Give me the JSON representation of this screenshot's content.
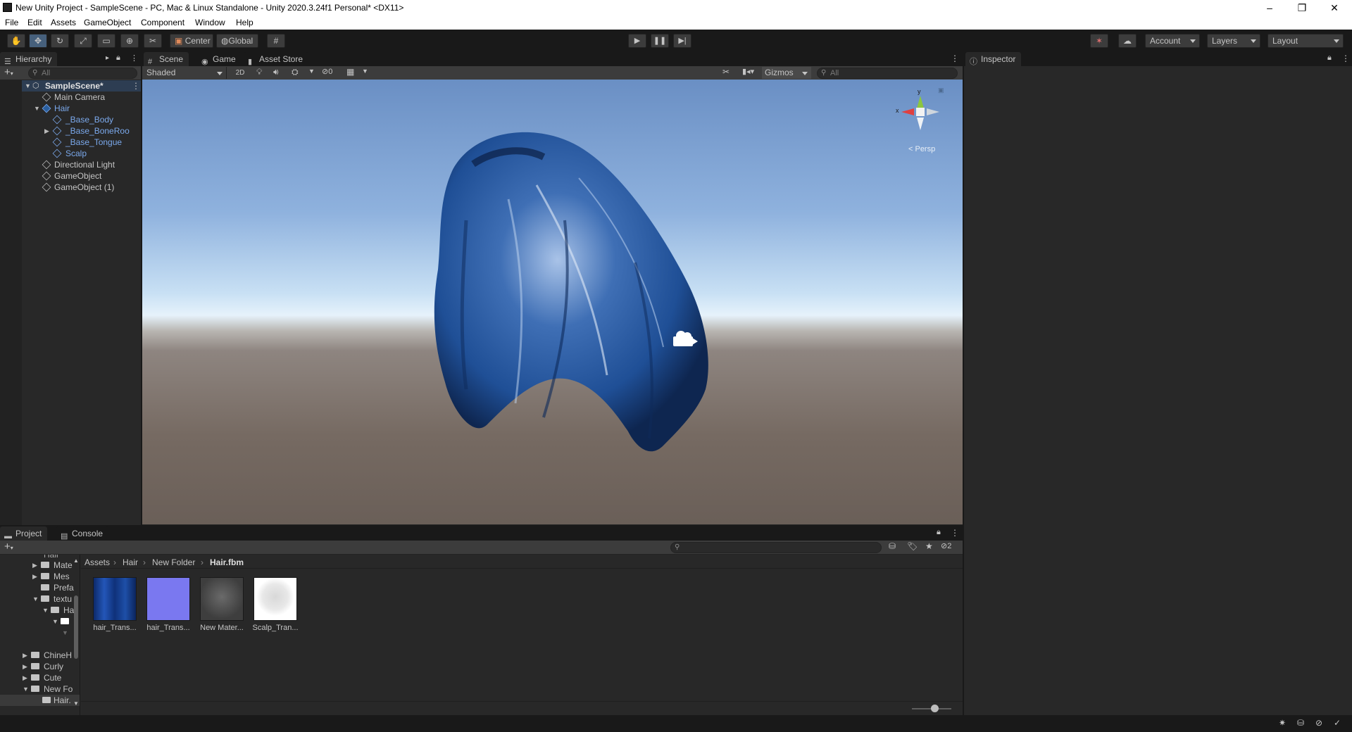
{
  "window": {
    "title": "New Unity Project - SampleScene - PC, Mac & Linux Standalone - Unity 2020.3.24f1 Personal* <DX11>",
    "controls": [
      "–",
      "❐",
      "✕"
    ]
  },
  "menu": [
    "File",
    "Edit",
    "Assets",
    "GameObject",
    "Component",
    "Window",
    "Help"
  ],
  "toolbar": {
    "pivot_label": "Center",
    "space_label": "Global",
    "account_label": "Account",
    "layers_label": "Layers",
    "layout_label": "Layout"
  },
  "hierarchy": {
    "tab_label": "Hierarchy",
    "search_placeholder": "All",
    "scene_name": "SampleScene*",
    "items": [
      {
        "label": "Main Camera"
      },
      {
        "label": "Hair"
      },
      {
        "label": "_Base_Body"
      },
      {
        "label": "_Base_BoneRoo"
      },
      {
        "label": "_Base_Tongue"
      },
      {
        "label": "Scalp"
      },
      {
        "label": "Directional Light"
      },
      {
        "label": "GameObject"
      },
      {
        "label": "GameObject (1)"
      }
    ]
  },
  "scene": {
    "tabs": [
      "Scene",
      "Game",
      "Asset Store"
    ],
    "shading_mode": "Shaded",
    "mode_2d": "2D",
    "hidden_count": "0",
    "gizmos_label": "Gizmos",
    "search_placeholder": "All",
    "gizmo_x": "x",
    "gizmo_y": "y",
    "projection": "< Persp",
    "colors": {
      "hair": "#1f4f96",
      "sky": "#8fb2de",
      "ground": "#766a62"
    }
  },
  "inspector": {
    "tab_label": "Inspector"
  },
  "project": {
    "tabs": [
      "Project",
      "Console"
    ],
    "hidden_count": "2",
    "breadcrumb": [
      "Assets",
      "Hair",
      "New Folder",
      "Hair.fbm"
    ],
    "tree": [
      {
        "label": "Hair"
      },
      {
        "label": "Mate"
      },
      {
        "label": "Mes"
      },
      {
        "label": "Prefa"
      },
      {
        "label": "textu"
      },
      {
        "label": "Ha"
      },
      {
        "label": "ChineH"
      },
      {
        "label": "Curly"
      },
      {
        "label": "Cute"
      },
      {
        "label": "New Fo"
      },
      {
        "label": "Hair."
      }
    ],
    "assets": [
      {
        "label": "hair_Trans...",
        "color": "#1a3f8f"
      },
      {
        "label": "hair_Trans...",
        "color": "#7a78f0"
      },
      {
        "label": "New Mater...",
        "color": "#4a4a4a"
      },
      {
        "label": "Scalp_Tran...",
        "color": "#ffffff"
      }
    ]
  }
}
